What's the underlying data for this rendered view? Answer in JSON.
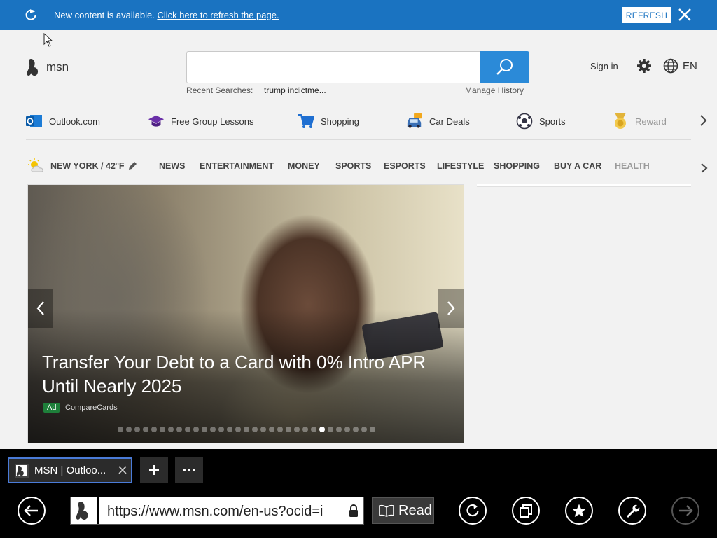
{
  "notification": {
    "message": "New content is available.",
    "link": "Click here to refresh the page.",
    "button": "REFRESH"
  },
  "header": {
    "brand": "msn",
    "search_placeholder": "",
    "recent_label": "Recent Searches:",
    "recent_item": "trump indictme...",
    "manage_history": "Manage History",
    "sign_in": "Sign in",
    "language": "EN"
  },
  "quick_links": [
    {
      "label": "Outlook.com",
      "icon": "outlook-icon"
    },
    {
      "label": "Free Group Lessons",
      "icon": "graduation-cap-icon"
    },
    {
      "label": "Shopping",
      "icon": "shopping-cart-icon"
    },
    {
      "label": "Car Deals",
      "icon": "car-icon"
    },
    {
      "label": "Sports",
      "icon": "soccer-ball-icon"
    },
    {
      "label": "Reward",
      "icon": "medal-icon"
    }
  ],
  "nav": {
    "weather": "NEW YORK / 42°F",
    "categories": [
      "NEWS",
      "ENTERTAINMENT",
      "MONEY",
      "SPORTS",
      "ESPORTS",
      "LIFESTYLE",
      "SHOPPING",
      "BUY A CAR",
      "HEALTH"
    ]
  },
  "carousel": {
    "headline": "Transfer Your Debt to a Card with 0% Intro APR Until Nearly 2025",
    "ad_badge": "Ad",
    "sponsor": "CompareCards",
    "total_slides": 31,
    "active_slide": 25
  },
  "browser": {
    "tab_title": "MSN | Outloo...",
    "url": "https://www.msn.com/en-us?ocid=i",
    "read_label": "Read"
  },
  "colors": {
    "notify_bar": "#1a73c1",
    "search_button": "#2b8ad8",
    "ad_badge": "#1e7f3a",
    "tab_border": "#4a7bd8"
  }
}
